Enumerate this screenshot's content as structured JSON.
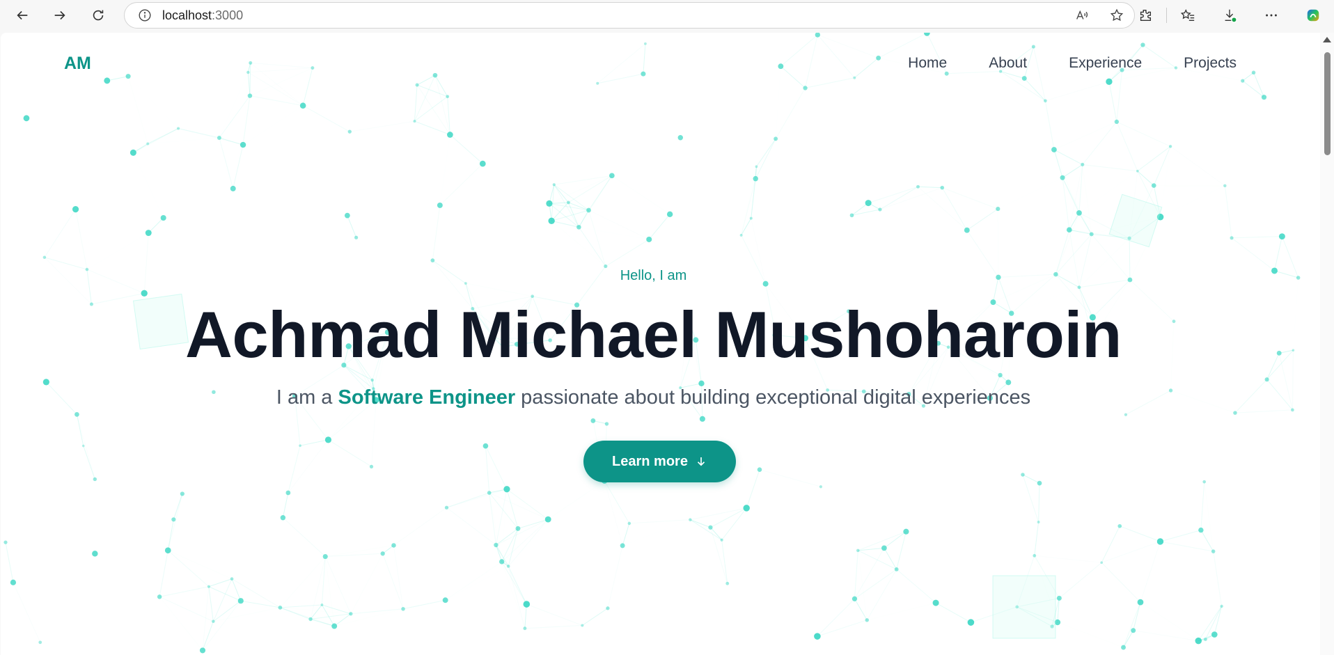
{
  "browser": {
    "url_host": "localhost",
    "url_port": ":3000",
    "icons": [
      "back-icon",
      "forward-icon",
      "refresh-icon",
      "info-icon",
      "read-aloud-icon",
      "favorite-star-icon",
      "extensions-icon",
      "favorites-icon",
      "downloads-icon",
      "more-icon",
      "copilot-icon"
    ]
  },
  "site": {
    "logo": "AM",
    "nav": [
      "Home",
      "About",
      "Experience",
      "Projects"
    ],
    "accent_color": "#0d9488",
    "hero": {
      "greeting": "Hello, I am",
      "name": "Achmad Michael Mushoharoin",
      "tagline_prefix": "I am a ",
      "tagline_role": "Software Engineer",
      "tagline_suffix": " passionate about building exceptional digital experiences",
      "cta_label": "Learn more",
      "cta_icon": "arrow-down-icon"
    }
  }
}
